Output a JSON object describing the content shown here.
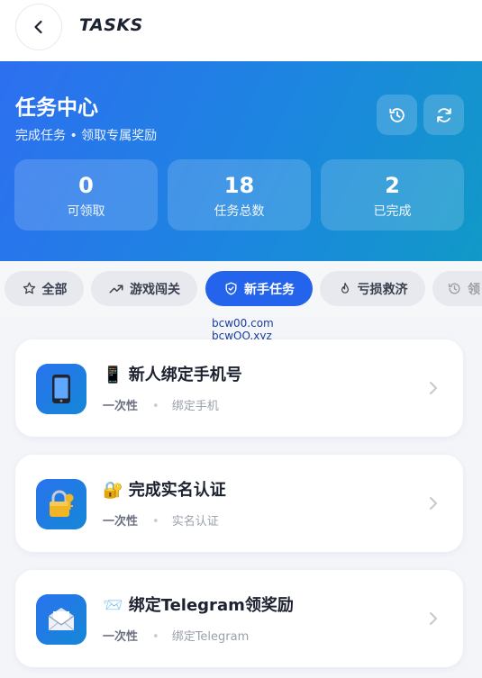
{
  "header": {
    "title": "TASKS",
    "back_icon": "chevron-left-icon"
  },
  "hero": {
    "title": "任务中心",
    "subtitle": "完成任务 • 领取专属奖励",
    "buttons": [
      {
        "icon": "history-icon"
      },
      {
        "icon": "refresh-icon"
      }
    ],
    "stats": [
      {
        "value": "0",
        "label": "可领取"
      },
      {
        "value": "18",
        "label": "任务总数"
      },
      {
        "value": "2",
        "label": "已完成"
      }
    ],
    "gradient_start": "#2d6ff0",
    "gradient_end": "#1199c7"
  },
  "tabs": [
    {
      "label": "全部",
      "icon": "star-icon",
      "active": false
    },
    {
      "label": "游戏闯关",
      "icon": "trend-up-icon",
      "active": false
    },
    {
      "label": "新手任务",
      "icon": "shield-icon",
      "active": true
    },
    {
      "label": "亏损救济",
      "icon": "flame-icon",
      "active": false
    },
    {
      "label": "领",
      "icon": "history-icon",
      "active": false
    }
  ],
  "accent_color": "#2463eb",
  "watermark": {
    "line1": "bcw00.com",
    "line2": "bcwOO.xyz"
  },
  "tasks": [
    {
      "emoji": "📱",
      "title": "新人绑定手机号",
      "type": "一次性",
      "category": "绑定手机",
      "icon": "phone-icon"
    },
    {
      "emoji": "🔐",
      "title": "完成实名认证",
      "type": "一次性",
      "category": "实名认证",
      "icon": "lock-key-icon"
    },
    {
      "emoji": "📨",
      "title": "绑定Telegram领奖励",
      "type": "一次性",
      "category": "绑定Telegram",
      "icon": "envelope-icon"
    }
  ]
}
